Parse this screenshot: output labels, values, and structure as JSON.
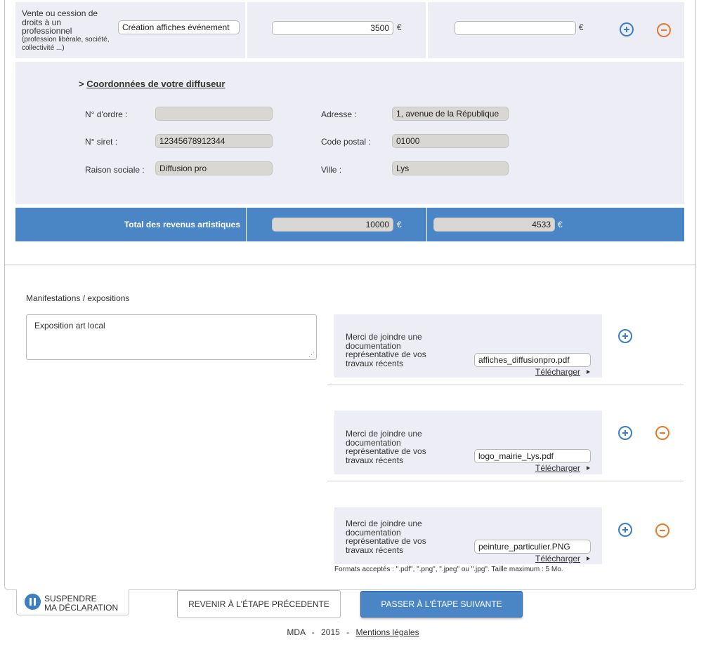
{
  "income_row": {
    "label_main": "Vente ou cession de droits à un professionnel",
    "label_sub": "(profession libérale, société, collectivité ...)",
    "description": "Création affiches événement",
    "amount_1": "3500",
    "amount_2": "",
    "currency": "€"
  },
  "diffuseur": {
    "title_prefix": ">",
    "title": "Coordonnées de votre diffuseur",
    "ordre_label": "N° d'ordre :",
    "ordre_value": "",
    "siret_label": "N° siret :",
    "siret_value": "12345678912344",
    "raison_label": "Raison sociale :",
    "raison_value": "Diffusion pro",
    "adresse_label": "Adresse :",
    "adresse_value": "1, avenue de la République",
    "cp_label": "Code postal :",
    "cp_value": "01000",
    "ville_label": "Ville :",
    "ville_value": "Lys"
  },
  "total": {
    "label": "Total des revenus artistiques",
    "value_1": "10000",
    "value_2": "4533",
    "currency": "€"
  },
  "manifestations": {
    "label": "Manifestations / expositions",
    "value": "Exposition art local"
  },
  "uploads": {
    "prompt": "Merci de joindre une documentation représentative de vos travaux récents",
    "download_label": "Télécharger",
    "files": [
      "affiches_diffusionpro.pdf",
      "logo_mairie_Lys.pdf",
      "peinture_particulier.PNG"
    ],
    "formats_note": "Formats acceptés : \".pdf\", \".png\", \".jpeg\" ou \".jpg\". Taille maximum : 5 Mo."
  },
  "buttons": {
    "suspend_line1": "SUSPENDRE",
    "suspend_line2": "MA DÉCLARATION",
    "previous": "REVENIR À L'ÉTAPE PRÉCEDENTE",
    "next": "PASSER À L'ÉTAPE SUIVANTE"
  },
  "footer": {
    "org": "MDA",
    "sep": "-",
    "year": "2015",
    "legal": "Mentions légales"
  },
  "colors": {
    "accent_blue": "#4a86c5",
    "lavender": "#ededf5",
    "plus_icon": "#3a7fc6",
    "minus_icon": "#e8782a"
  }
}
